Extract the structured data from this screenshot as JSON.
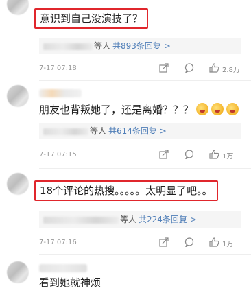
{
  "comments": [
    {
      "text": "意识到自己没演技了？",
      "reply_suffix": "等人",
      "reply_count": "共893条回复 >",
      "date": "7-17 07:18",
      "likes": "2.8万"
    },
    {
      "text": "朋友也背叛她了，还是离婚？？？",
      "reply_suffix": "等人",
      "reply_count": "共614条回复 >",
      "date": "7-17 07:15",
      "likes": "1万"
    },
    {
      "text": "18个评论的热搜。。。。。太明显了吧。。",
      "reply_suffix": "等人",
      "reply_count": "共224条回复 >",
      "date": "7-17 07:16",
      "likes": "1万"
    },
    {
      "text": "看到她就神烦"
    }
  ],
  "icons": {
    "share": "share-icon",
    "comment": "comment-icon",
    "like": "thumbs-up-icon",
    "emoji": "grinning-face-emoji"
  },
  "colors": {
    "highlight_box": "#e0262c",
    "reply_link": "#4e7db7",
    "meta_text": "#999999"
  }
}
